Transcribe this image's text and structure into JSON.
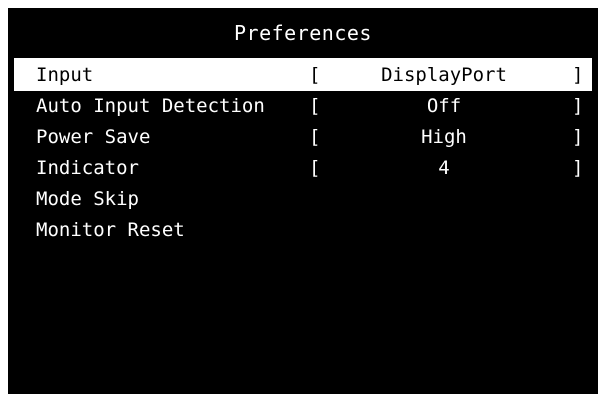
{
  "menu": {
    "title": "Preferences",
    "items": [
      {
        "label": "Input",
        "open": "[",
        "value": "DisplayPort",
        "close": "]",
        "selected": true
      },
      {
        "label": "Auto Input Detection",
        "open": "[",
        "value": "Off",
        "close": "]",
        "selected": false
      },
      {
        "label": "Power Save",
        "open": "[",
        "value": "High",
        "close": "]",
        "selected": false
      },
      {
        "label": "Indicator",
        "open": "[",
        "value": "4",
        "close": "]",
        "selected": false
      },
      {
        "label": "Mode Skip",
        "selected": false
      },
      {
        "label": "Monitor Reset",
        "selected": false
      }
    ]
  },
  "colors": {
    "background": "#000000",
    "text": "#ffffff",
    "highlight_bg": "#ffffff",
    "highlight_text": "#000000"
  }
}
